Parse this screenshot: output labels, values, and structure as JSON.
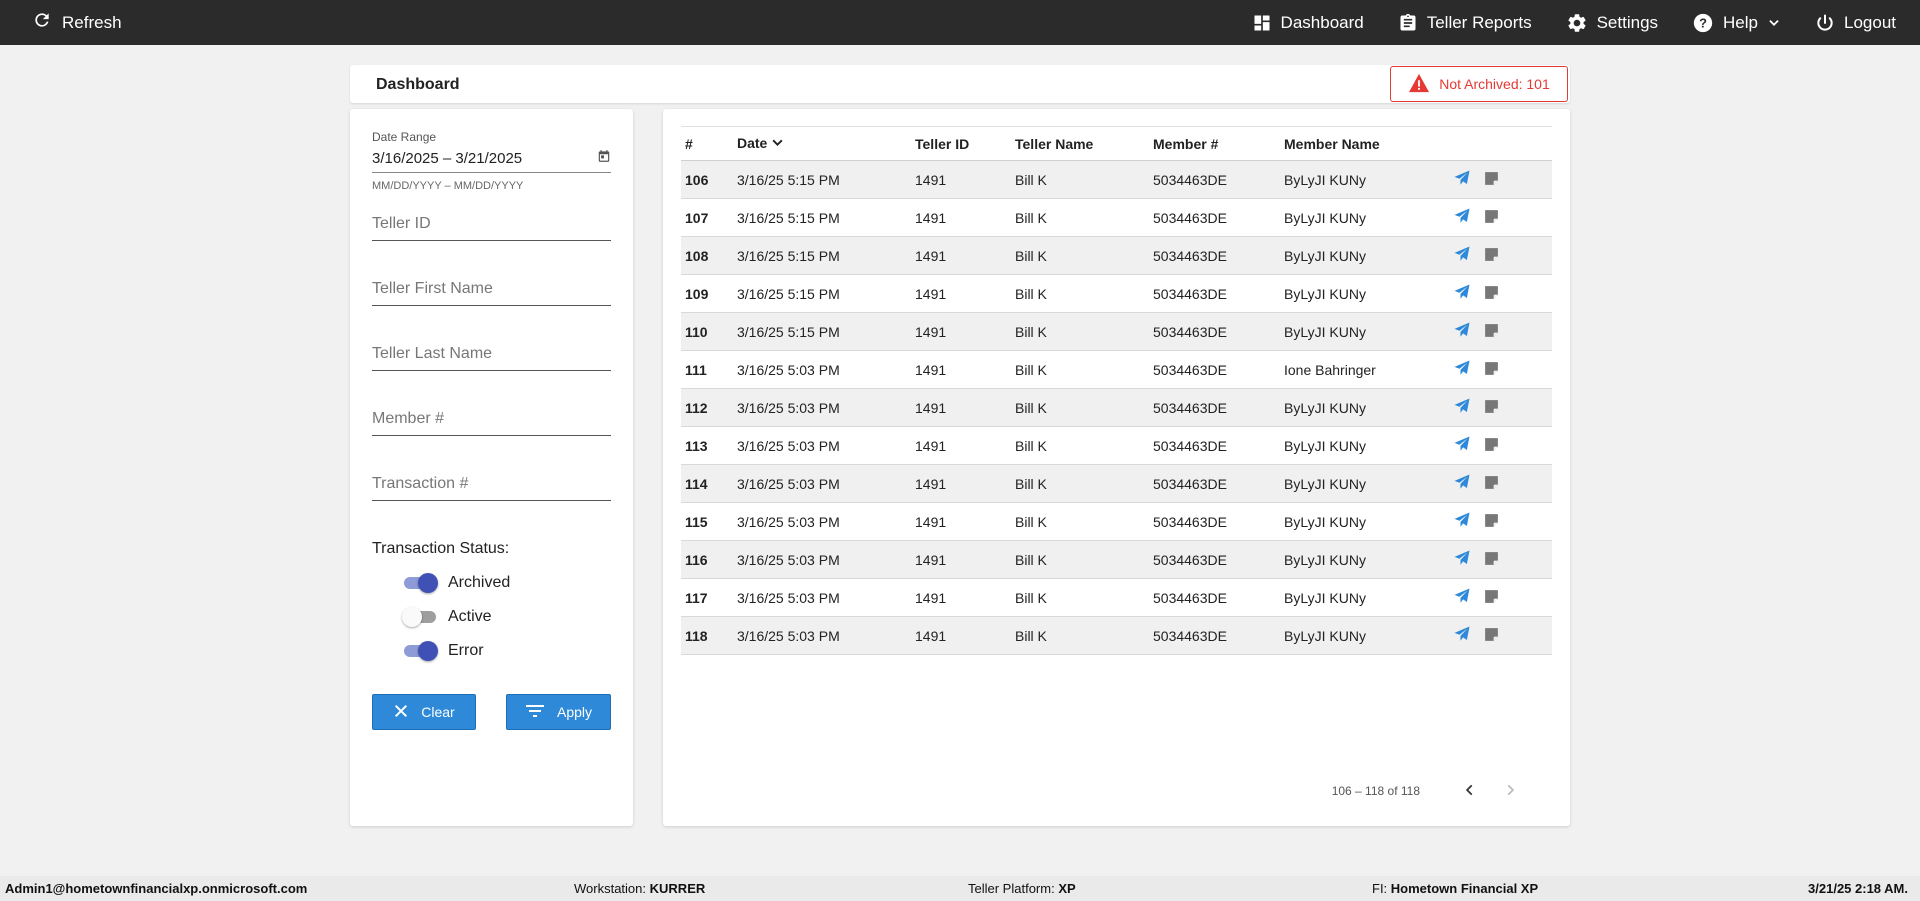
{
  "topbar": {
    "refresh_label": "Refresh",
    "nav": [
      {
        "label": "Dashboard",
        "icon": "dashboard-icon"
      },
      {
        "label": "Teller Reports",
        "icon": "clipboard-icon"
      },
      {
        "label": "Settings",
        "icon": "gear-icon"
      },
      {
        "label": "Help",
        "icon": "help-icon"
      },
      {
        "label": "Logout",
        "icon": "power-icon"
      }
    ]
  },
  "header": {
    "title": "Dashboard",
    "alert_label": "Not Archived: 101",
    "alert_color": "#e53935"
  },
  "filters": {
    "date_range_label": "Date Range",
    "date_range_value": "3/16/2025 – 3/21/2025",
    "date_range_hint": "MM/DD/YYYY – MM/DD/YYYY",
    "teller_id_placeholder": "Teller ID",
    "teller_first_name_placeholder": "Teller First Name",
    "teller_last_name_placeholder": "Teller Last Name",
    "member_placeholder": "Member #",
    "transaction_placeholder": "Transaction #",
    "status_title": "Transaction Status:",
    "statuses": [
      {
        "label": "Archived",
        "on": true
      },
      {
        "label": "Active",
        "on": false
      },
      {
        "label": "Error",
        "on": true
      }
    ],
    "clear_label": "Clear",
    "apply_label": "Apply"
  },
  "table": {
    "columns": [
      "#",
      "Date",
      "Teller ID",
      "Teller Name",
      "Member #",
      "Member Name"
    ],
    "rows": [
      {
        "num": "106",
        "date": "3/16/25 5:15 PM",
        "teller_id": "1491",
        "teller_name": "Bill K",
        "member": "5034463DE",
        "member_name": "ByLyJI KUNy"
      },
      {
        "num": "107",
        "date": "3/16/25 5:15 PM",
        "teller_id": "1491",
        "teller_name": "Bill K",
        "member": "5034463DE",
        "member_name": "ByLyJI KUNy"
      },
      {
        "num": "108",
        "date": "3/16/25 5:15 PM",
        "teller_id": "1491",
        "teller_name": "Bill K",
        "member": "5034463DE",
        "member_name": "ByLyJI KUNy"
      },
      {
        "num": "109",
        "date": "3/16/25 5:15 PM",
        "teller_id": "1491",
        "teller_name": "Bill K",
        "member": "5034463DE",
        "member_name": "ByLyJI KUNy"
      },
      {
        "num": "110",
        "date": "3/16/25 5:15 PM",
        "teller_id": "1491",
        "teller_name": "Bill K",
        "member": "5034463DE",
        "member_name": "ByLyJI KUNy"
      },
      {
        "num": "111",
        "date": "3/16/25 5:03 PM",
        "teller_id": "1491",
        "teller_name": "Bill K",
        "member": "5034463DE",
        "member_name": "Ione Bahringer"
      },
      {
        "num": "112",
        "date": "3/16/25 5:03 PM",
        "teller_id": "1491",
        "teller_name": "Bill K",
        "member": "5034463DE",
        "member_name": "ByLyJI KUNy"
      },
      {
        "num": "113",
        "date": "3/16/25 5:03 PM",
        "teller_id": "1491",
        "teller_name": "Bill K",
        "member": "5034463DE",
        "member_name": "ByLyJI KUNy"
      },
      {
        "num": "114",
        "date": "3/16/25 5:03 PM",
        "teller_id": "1491",
        "teller_name": "Bill K",
        "member": "5034463DE",
        "member_name": "ByLyJI KUNy"
      },
      {
        "num": "115",
        "date": "3/16/25 5:03 PM",
        "teller_id": "1491",
        "teller_name": "Bill K",
        "member": "5034463DE",
        "member_name": "ByLyJI KUNy"
      },
      {
        "num": "116",
        "date": "3/16/25 5:03 PM",
        "teller_id": "1491",
        "teller_name": "Bill K",
        "member": "5034463DE",
        "member_name": "ByLyJI KUNy"
      },
      {
        "num": "117",
        "date": "3/16/25 5:03 PM",
        "teller_id": "1491",
        "teller_name": "Bill K",
        "member": "5034463DE",
        "member_name": "ByLyJI KUNy"
      },
      {
        "num": "118",
        "date": "3/16/25 5:03 PM",
        "teller_id": "1491",
        "teller_name": "Bill K",
        "member": "5034463DE",
        "member_name": "ByLyJI KUNy"
      }
    ],
    "action_icons": [
      "send-icon",
      "note-icon"
    ],
    "pager_range": "106 – 118 of 118"
  },
  "footer": {
    "user": "Admin1@hometownfinancialxp.onmicrosoft.com",
    "workstation_label": "Workstation:",
    "workstation_value": "KURRER",
    "platform_label": "Teller Platform:",
    "platform_value": "XP",
    "fi_label": "FI:",
    "fi_value": "Hometown Financial XP",
    "datetime": "3/21/25 2:18 AM."
  },
  "colors": {
    "topbar": "#2b2b2b",
    "accent_blue": "#2e8ad8",
    "toggle_on": "#3f51b5",
    "alert": "#e53935"
  }
}
